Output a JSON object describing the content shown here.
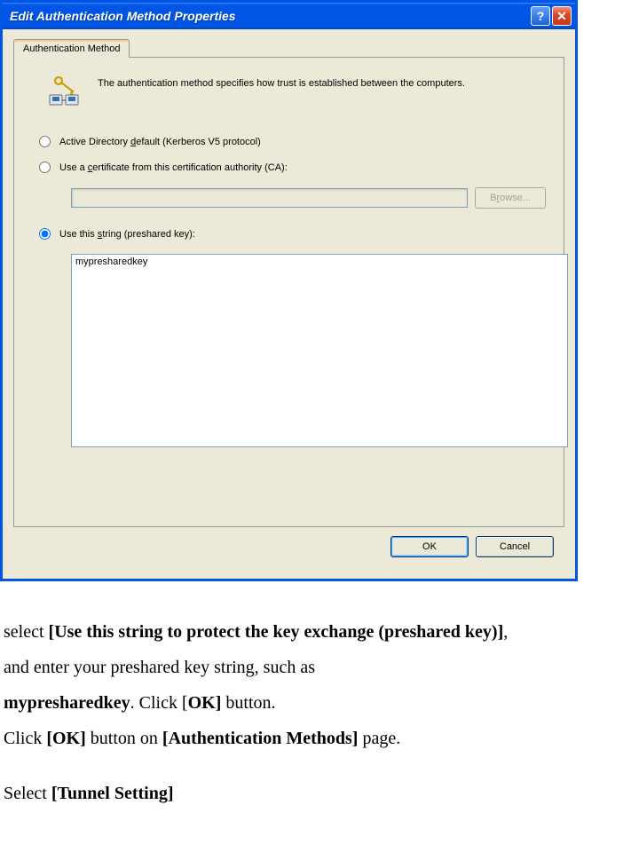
{
  "dialog": {
    "title": "Edit Authentication Method Properties",
    "help_btn": "?",
    "close_btn": "✕",
    "tab_label": "Authentication Method",
    "info_text": "The authentication method specifies how trust is established between the computers.",
    "radio1_pre": "Active Directory ",
    "radio1_u": "d",
    "radio1_post": "efault (Kerberos V5 protocol)",
    "radio2_pre": "Use a ",
    "radio2_u": "c",
    "radio2_post": "ertificate from this certification authority (CA):",
    "ca_value": "",
    "browse_pre": "B",
    "browse_u": "r",
    "browse_post": "owse...",
    "radio3_pre": "Use this ",
    "radio3_u": "s",
    "radio3_post": "tring (preshared key):",
    "psk_value": "mypresharedkey",
    "ok_label": "OK",
    "cancel_label": "Cancel"
  },
  "instructions": {
    "line1_pre": "select ",
    "line1_bold": "[Use this string to protect the key exchange (preshared key)]",
    "line1_post": ",",
    "line2": "and enter your preshared key string, such as",
    "line3_bold1": "mypresharedkey",
    "line3_mid": ". Click [",
    "line3_bold2": "OK]",
    "line3_post": " button.",
    "line4_pre": "Click ",
    "line4_bold1": "[OK]",
    "line4_mid": " button on ",
    "line4_bold2": "[Authentication Methods]",
    "line4_post": " page.",
    "line5_pre": "Select ",
    "line5_bold": "[Tunnel Setting]"
  }
}
